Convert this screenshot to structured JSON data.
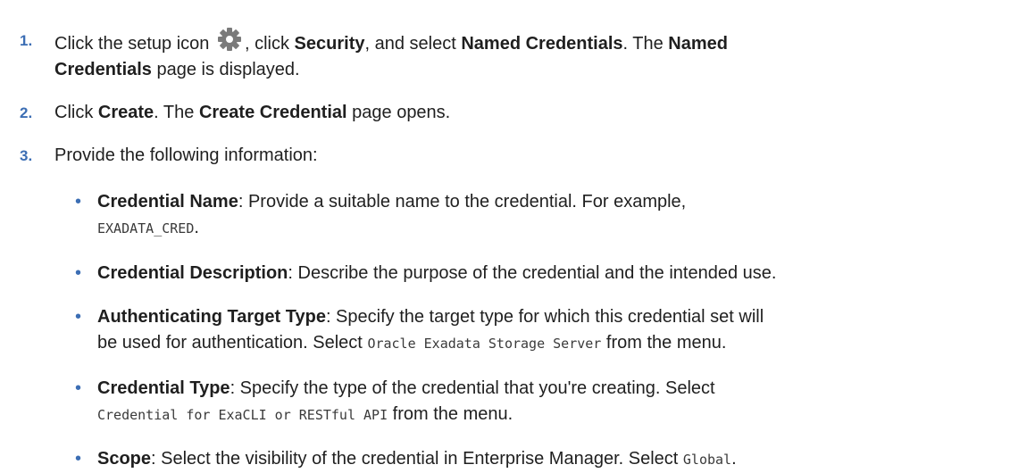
{
  "steps": [
    {
      "num": "1.",
      "t1": "Click the setup icon",
      "t2": ", click",
      "b1": "Security",
      "t3": ", and select",
      "b2": "Named Credentials",
      "t4": ". The",
      "b3": "Named",
      "b4": "Credentials",
      "t5": "page is displayed."
    },
    {
      "num": "2.",
      "t1": "Click",
      "b1": "Create",
      "t2": ". The",
      "b2": "Create Credential",
      "t3": "page opens."
    },
    {
      "num": "3.",
      "t1": "Provide the following information:"
    }
  ],
  "bullets": [
    {
      "label": "Credential Name",
      "t1": ": Provide a suitable name to the credential. For example,",
      "code1": "EXADATA_CRED",
      "t2": "."
    },
    {
      "label": "Credential Description",
      "t1": ": Describe the purpose of the credential and the intended use."
    },
    {
      "label": "Authenticating Target Type",
      "t1": ": Specify the target type for which this credential set will",
      "t2": "be used for authentication. Select",
      "code1": "Oracle Exadata Storage Server",
      "t3": "from the menu."
    },
    {
      "label": "Credential Type",
      "t1": ": Specify the type of the credential that you're creating. Select",
      "code1": "Credential for ExaCLI or RESTful API",
      "t2": "from the menu."
    },
    {
      "label": "Scope",
      "t1": ": Select the visibility of the credential in Enterprise Manager. Select",
      "code1": "Global",
      "t2": "."
    }
  ],
  "bullet_glyph": "•",
  "icons": {
    "setup": "gear-icon"
  },
  "colors": {
    "accent": "#3c6eb4",
    "text": "#1f1f1f"
  }
}
